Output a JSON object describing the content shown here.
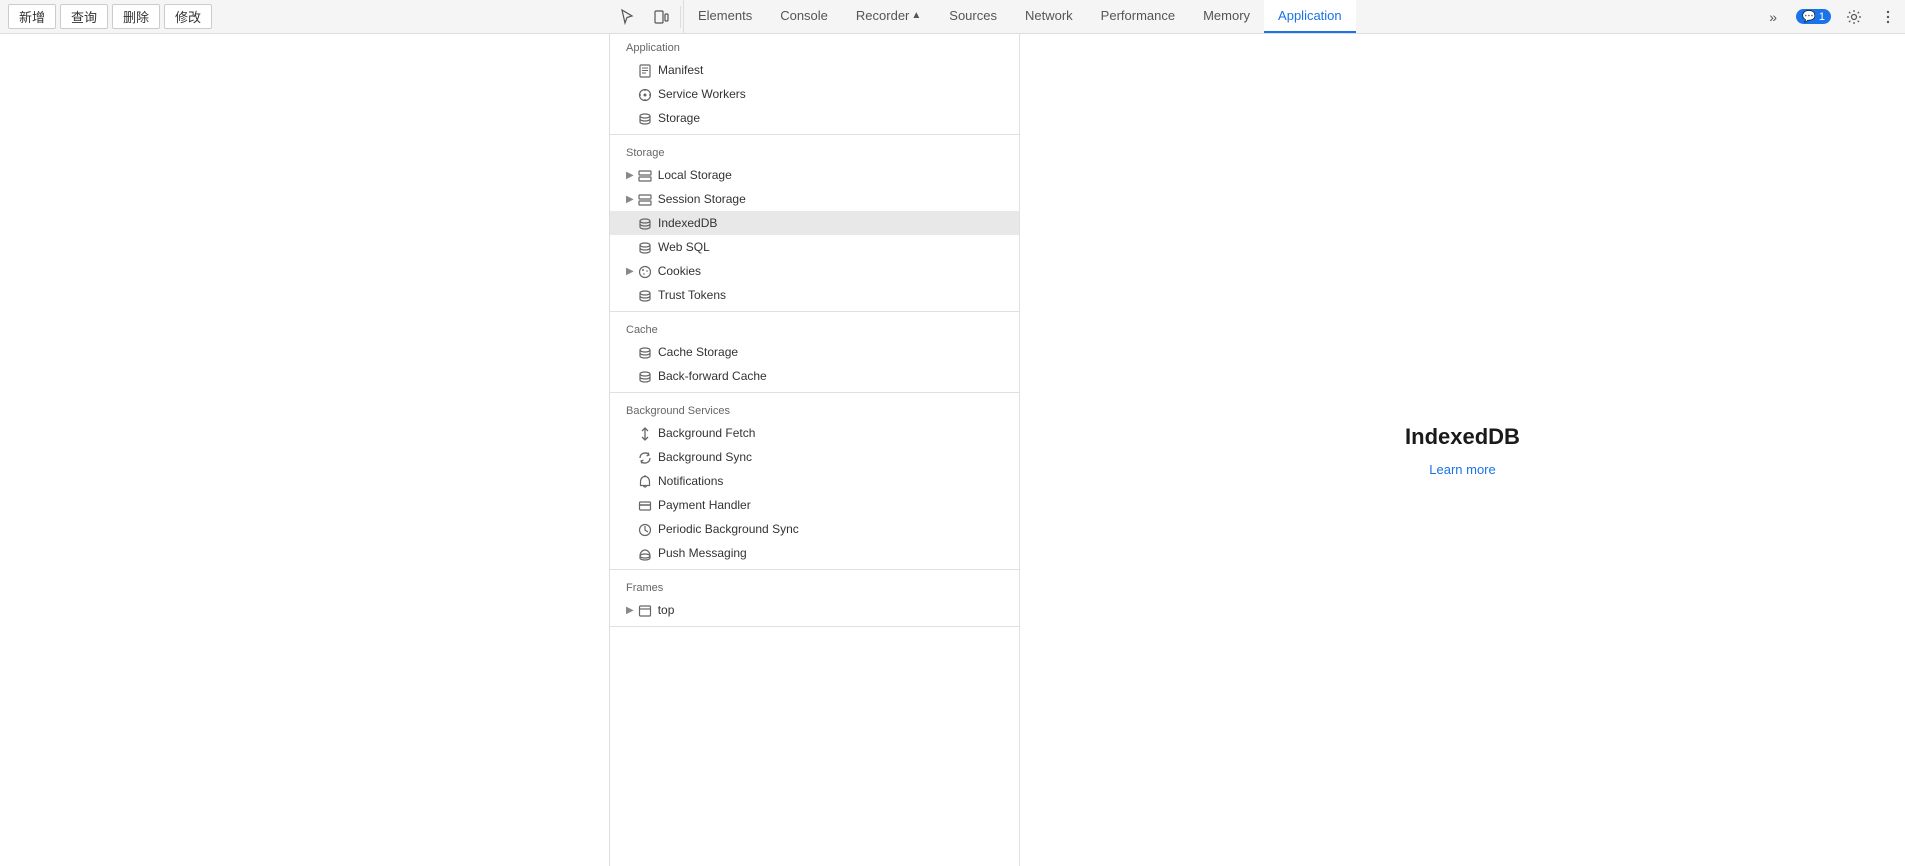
{
  "app_toolbar": {
    "buttons": [
      "新增",
      "查询",
      "删除",
      "修改"
    ]
  },
  "devtools": {
    "icon_buttons": [
      "cursor-icon",
      "device-icon"
    ],
    "tabs": [
      {
        "id": "elements",
        "label": "Elements",
        "active": false
      },
      {
        "id": "console",
        "label": "Console",
        "active": false
      },
      {
        "id": "recorder",
        "label": "Recorder",
        "active": false
      },
      {
        "id": "sources",
        "label": "Sources",
        "active": false
      },
      {
        "id": "network",
        "label": "Network",
        "active": false
      },
      {
        "id": "performance",
        "label": "Performance",
        "active": false
      },
      {
        "id": "memory",
        "label": "Memory",
        "active": false
      },
      {
        "id": "application",
        "label": "Application",
        "active": true
      }
    ],
    "more_tabs": "»",
    "badge_count": "1",
    "badge_prefix": "💬"
  },
  "sidebar": {
    "sections": [
      {
        "id": "application",
        "label": "Application",
        "items": [
          {
            "id": "manifest",
            "label": "Manifest",
            "icon": "📄",
            "indent": false
          },
          {
            "id": "service-workers",
            "label": "Service Workers",
            "icon": "⚙️",
            "indent": false
          },
          {
            "id": "storage",
            "label": "Storage",
            "icon": "🗄️",
            "indent": false
          }
        ]
      },
      {
        "id": "storage",
        "label": "Storage",
        "items": [
          {
            "id": "local-storage",
            "label": "Local Storage",
            "icon": "▦",
            "arrow": true,
            "indent": false
          },
          {
            "id": "session-storage",
            "label": "Session Storage",
            "icon": "▦",
            "arrow": true,
            "indent": false
          },
          {
            "id": "indexeddb",
            "label": "IndexedDB",
            "icon": "🗄️",
            "active": true,
            "indent": false
          },
          {
            "id": "web-sql",
            "label": "Web SQL",
            "icon": "🗄️",
            "indent": false
          },
          {
            "id": "cookies",
            "label": "Cookies",
            "icon": "🌐",
            "arrow": true,
            "indent": false
          },
          {
            "id": "trust-tokens",
            "label": "Trust Tokens",
            "icon": "🗄️",
            "indent": false
          }
        ]
      },
      {
        "id": "cache",
        "label": "Cache",
        "items": [
          {
            "id": "cache-storage",
            "label": "Cache Storage",
            "icon": "🗄️",
            "indent": false
          },
          {
            "id": "back-forward-cache",
            "label": "Back-forward Cache",
            "icon": "🗄️",
            "indent": false
          }
        ]
      },
      {
        "id": "background-services",
        "label": "Background Services",
        "items": [
          {
            "id": "background-fetch",
            "label": "Background Fetch",
            "icon": "↕",
            "indent": false
          },
          {
            "id": "background-sync",
            "label": "Background Sync",
            "icon": "↺",
            "indent": false
          },
          {
            "id": "notifications",
            "label": "Notifications",
            "icon": "🔔",
            "indent": false
          },
          {
            "id": "payment-handler",
            "label": "Payment Handler",
            "icon": "💳",
            "indent": false
          },
          {
            "id": "periodic-background-sync",
            "label": "Periodic Background Sync",
            "icon": "⏱",
            "indent": false
          },
          {
            "id": "push-messaging",
            "label": "Push Messaging",
            "icon": "☁",
            "indent": false
          }
        ]
      },
      {
        "id": "frames",
        "label": "Frames",
        "items": [
          {
            "id": "top-frame",
            "label": "top",
            "icon": "🗂",
            "arrow": true,
            "indent": false
          }
        ]
      }
    ]
  },
  "main_panel": {
    "title": "IndexedDB",
    "learn_more_label": "Learn more"
  }
}
